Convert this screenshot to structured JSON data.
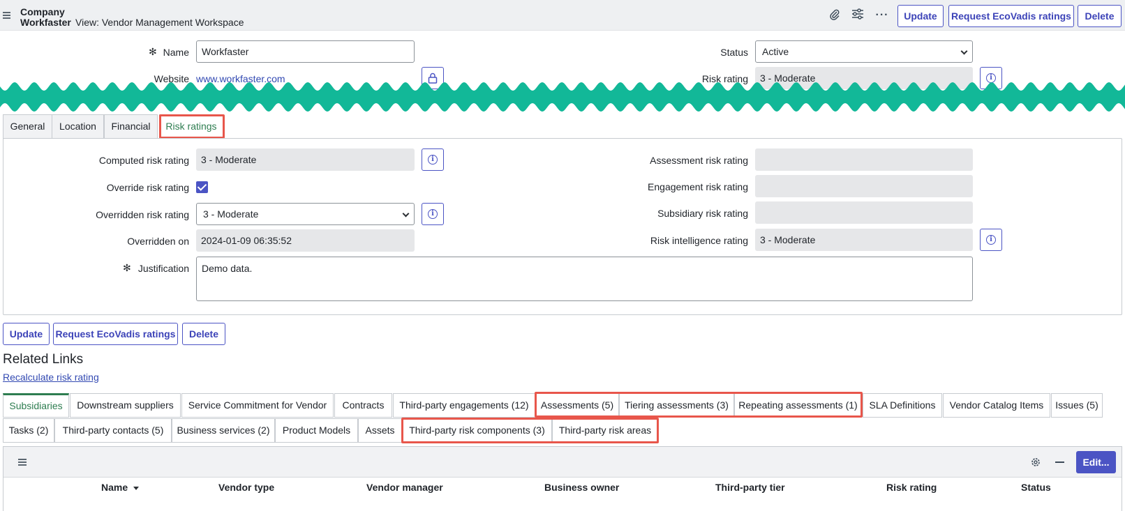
{
  "header": {
    "record_type": "Company",
    "record_name": "Workfaster",
    "view_label": "View: Vendor Management Workspace",
    "icons": [
      "paperclip-icon",
      "sliders-icon",
      "more-icon"
    ],
    "buttons": {
      "update": "Update",
      "ecovadis": "Request EcoVadis ratings",
      "delete": "Delete"
    }
  },
  "top_fields": {
    "name_label": "Name",
    "name_value": "Workfaster",
    "website_label": "Website",
    "website_value": "www.workfaster.com",
    "status_label": "Status",
    "status_value": "Active",
    "risk_rating_label": "Risk rating",
    "risk_rating_value": "3 - Moderate"
  },
  "tabs": [
    {
      "label": "General"
    },
    {
      "label": "Location"
    },
    {
      "label": "Financial"
    },
    {
      "label": "Risk ratings"
    }
  ],
  "risk_panel": {
    "computed_label": "Computed risk rating",
    "computed_value": "3 - Moderate",
    "override_label": "Override risk rating",
    "override_checked": true,
    "overridden_label": "Overridden risk rating",
    "overridden_value": "3 - Moderate",
    "overridden_on_label": "Overridden on",
    "overridden_on_value": "2024-01-09 06:35:52",
    "justification_label": "Justification",
    "justification_value": "Demo data.",
    "assessment_label": "Assessment risk rating",
    "assessment_value": "",
    "engagement_label": "Engagement risk rating",
    "engagement_value": "",
    "subsidiary_label": "Subsidiary risk rating",
    "subsidiary_value": "",
    "intel_label": "Risk intelligence rating",
    "intel_value": "3 - Moderate"
  },
  "bottom_buttons": {
    "update": "Update",
    "ecovadis": "Request EcoVadis ratings",
    "delete": "Delete"
  },
  "related": {
    "title": "Related Links",
    "recalc": "Recalculate risk rating"
  },
  "related_tabs_row1": [
    {
      "label": "Subsidiaries"
    },
    {
      "label": "Downstream suppliers"
    },
    {
      "label": "Service Commitment for Vendor"
    },
    {
      "label": "Contracts"
    },
    {
      "label": "Third-party engagements (12)"
    },
    {
      "label": "Assessments (5)"
    },
    {
      "label": "Tiering assessments (3)"
    },
    {
      "label": "Repeating assessments (1)"
    },
    {
      "label": "SLA Definitions"
    },
    {
      "label": "Vendor Catalog Items"
    },
    {
      "label": "Issues (5)"
    }
  ],
  "related_tabs_row2": [
    {
      "label": "Tasks (2)"
    },
    {
      "label": "Third-party contacts (5)"
    },
    {
      "label": "Business services (2)"
    },
    {
      "label": "Product Models"
    },
    {
      "label": "Assets"
    },
    {
      "label": "Third-party risk components (3)"
    },
    {
      "label": "Third-party risk areas"
    }
  ],
  "list": {
    "edit_label": "Edit...",
    "columns": [
      "Name",
      "Vendor type",
      "Vendor manager",
      "Business owner",
      "Third-party tier",
      "Risk rating",
      "Status"
    ]
  },
  "colors": {
    "accent": "#4b54c4",
    "active_tab": "#2e7d50",
    "highlight": "#e8564b",
    "wave": "#12b898"
  }
}
